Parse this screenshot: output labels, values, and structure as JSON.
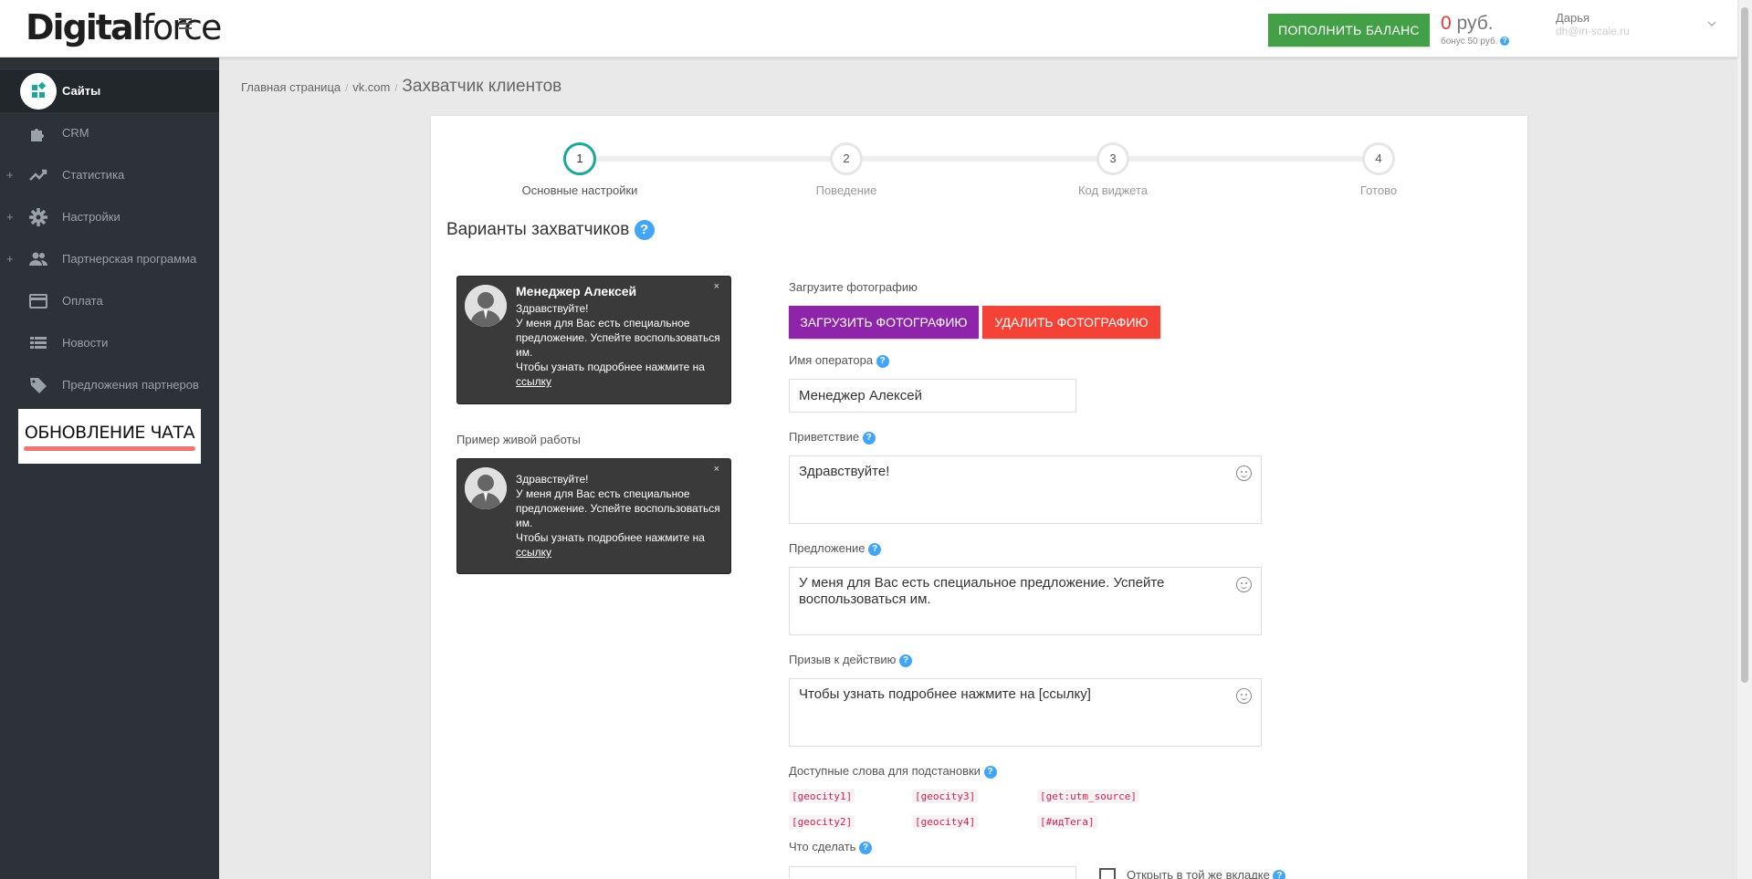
{
  "header": {
    "logo_bold": "Digital",
    "logo_light": "force",
    "topup_label": "ПОПОЛНИТЬ БАЛАНС",
    "balance_amount": "0",
    "balance_currency": " руб.",
    "bonus_text": "бонус 50 руб.",
    "user_name": "Дарья",
    "user_email": "dh@in-scale.ru"
  },
  "sidebar": {
    "items": [
      {
        "label": "Сайты",
        "icon": "sites-icon",
        "active": true,
        "expandable": false
      },
      {
        "label": "CRM",
        "icon": "puzzle-icon",
        "active": false,
        "expandable": false
      },
      {
        "label": "Статистика",
        "icon": "trending-up-icon",
        "active": false,
        "expandable": true
      },
      {
        "label": "Настройки",
        "icon": "gear-icon",
        "active": false,
        "expandable": true
      },
      {
        "label": "Партнерская программа",
        "icon": "people-icon",
        "active": false,
        "expandable": true
      },
      {
        "label": "Оплата",
        "icon": "credit-card-icon",
        "active": false,
        "expandable": false
      },
      {
        "label": "Новости",
        "icon": "list-icon",
        "active": false,
        "expandable": false
      },
      {
        "label": "Предложения партнеров",
        "icon": "tag-icon",
        "active": false,
        "expandable": false
      }
    ],
    "plus_sign": "+",
    "update_banner": "ОБНОВЛЕНИЕ ЧАТА"
  },
  "breadcrumb": {
    "home": "Главная страница",
    "site": "vk.com",
    "current": "Захватчик клиентов",
    "separator": "/"
  },
  "stepper": {
    "steps": [
      {
        "number": "1",
        "label": "Основные настройки",
        "active": true
      },
      {
        "number": "2",
        "label": "Поведение",
        "active": false
      },
      {
        "number": "3",
        "label": "Код виджета",
        "active": false
      },
      {
        "number": "4",
        "label": "Готово",
        "active": false
      }
    ]
  },
  "section_title": "Варианты захватчиков",
  "help_glyph": "?",
  "preview": {
    "manager_name": "Менеджер Алексей",
    "greeting": "Здравствуйте!",
    "offer": "У меня для Вас есть специальное предложение. Успейте воспользоваться им.",
    "cta_prefix": "Чтобы узнать подробнее нажмите на",
    "cta_link": "ссылку",
    "close": "×",
    "live_label": "Пример живой работы"
  },
  "form": {
    "photo_label": "Загрузите фотографию",
    "upload_button": "ЗАГРУЗИТЬ ФОТОГРАФИЮ",
    "delete_button": "УДАЛИТЬ ФОТОГРАФИЮ",
    "operator_label": "Имя оператора",
    "operator_value": "Менеджер Алексей",
    "greeting_label": "Приветствие",
    "greeting_value": "Здравствуйте!",
    "offer_label": "Предложение",
    "offer_value": "У меня для Вас есть специальное предложение. Успейте воспользоваться им.",
    "cta_label": "Призыв к действию",
    "cta_value": "Чтобы узнать подробнее нажмите на [ссылку]",
    "tokens_label": "Доступные слова для подстановки",
    "tokens": [
      "[geocity1]",
      "[geocity3]",
      "[get:utm_source]",
      "[geocity2]",
      "[geocity4]",
      "[#идТега]"
    ],
    "action_label": "Что сделать",
    "same_tab_label": "Открыть в той же вкладке"
  },
  "colors": {
    "sidebar_bg": "#2c3238",
    "topup_green": "#43a047",
    "balance_red": "#e53935",
    "step_active": "#1aa997",
    "upload_purple": "#8e24aa",
    "delete_red": "#f44336",
    "help_blue": "#42a5f5"
  }
}
